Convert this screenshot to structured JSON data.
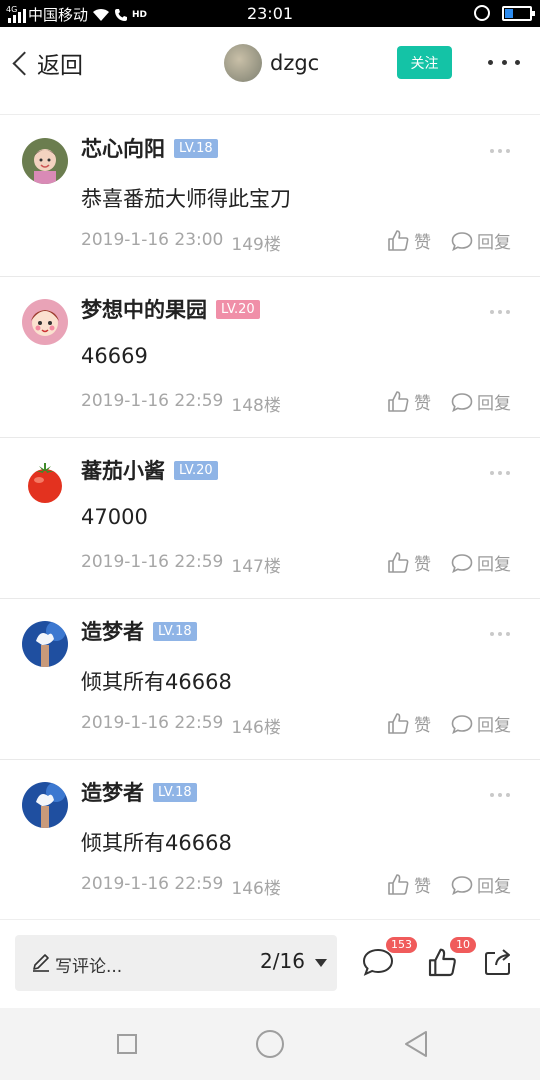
{
  "status_bar": {
    "network_type": "4G",
    "carrier": "中国移动",
    "hd_label": "HD",
    "time": "23:01"
  },
  "nav": {
    "back_label": "返回",
    "username": "dzgc",
    "follow_label": "关注"
  },
  "comments": [
    {
      "username": "芯心向阳",
      "level": "LV.18",
      "level_color": "#8fb4e6",
      "text": "恭喜番茄大师得此宝刀",
      "date": "2019-1-16 23:00",
      "floor": "149楼",
      "like_label": "赞",
      "reply_label": "回复",
      "avatar": "child-photo"
    },
    {
      "username": "梦想中的果园",
      "level": "LV.20",
      "level_color": "#f08fa8",
      "text": "46669",
      "date": "2019-1-16 22:59",
      "floor": "148楼",
      "like_label": "赞",
      "reply_label": "回复",
      "avatar": "cartoon-girl"
    },
    {
      "username": "蕃茄小酱",
      "level": "LV.20",
      "level_color": "#8fb4e6",
      "text": "47000",
      "date": "2019-1-16 22:59",
      "floor": "147楼",
      "like_label": "赞",
      "reply_label": "回复",
      "avatar": "tomato"
    },
    {
      "username": "造梦者",
      "level": "LV.18",
      "level_color": "#8fb4e6",
      "text": "倾其所有46668",
      "date": "2019-1-16 22:59",
      "floor": "146楼",
      "like_label": "赞",
      "reply_label": "回复",
      "avatar": "blue-sky-hand"
    },
    {
      "username": "造梦者",
      "level": "LV.18",
      "level_color": "#8fb4e6",
      "text": "倾其所有46668",
      "date": "2019-1-16 22:59",
      "floor": "146楼",
      "like_label": "赞",
      "reply_label": "回复",
      "avatar": "blue-sky-hand"
    }
  ],
  "bottom_bar": {
    "input_placeholder": "写评论...",
    "page_indicator": "2/16",
    "comment_count": "153",
    "like_count": "10"
  },
  "colors": {
    "accent": "#14c3a6",
    "badge": "#f05b5b"
  }
}
